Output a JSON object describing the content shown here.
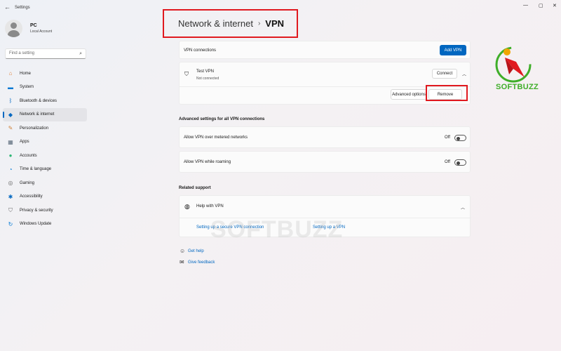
{
  "window": {
    "title": "Settings",
    "controls": {
      "minimize": "—",
      "maximize": "▢",
      "close": "✕"
    }
  },
  "account": {
    "name": "PC",
    "type": "Local Account"
  },
  "search": {
    "placeholder": "Find a setting"
  },
  "sidebar": {
    "items": [
      {
        "label": "Home",
        "icon": "home-icon",
        "glyph": "⌂",
        "color": "#e0823c"
      },
      {
        "label": "System",
        "icon": "monitor-icon",
        "glyph": "▬",
        "color": "#0078d4"
      },
      {
        "label": "Bluetooth & devices",
        "icon": "bluetooth-icon",
        "glyph": "ᛒ",
        "color": "#0067c0"
      },
      {
        "label": "Network & internet",
        "icon": "wifi-icon",
        "glyph": "◆",
        "color": "#0067c0"
      },
      {
        "label": "Personalization",
        "icon": "brush-icon",
        "glyph": "✎",
        "color": "#d0813a"
      },
      {
        "label": "Apps",
        "icon": "apps-icon",
        "glyph": "▦",
        "color": "#5b6b7b"
      },
      {
        "label": "Accounts",
        "icon": "person-icon",
        "glyph": "●",
        "color": "#2bb673"
      },
      {
        "label": "Time & language",
        "icon": "globe-clock-icon",
        "glyph": "◔",
        "color": "#0078d4"
      },
      {
        "label": "Gaming",
        "icon": "controller-icon",
        "glyph": "◎",
        "color": "#6b6b6b"
      },
      {
        "label": "Accessibility",
        "icon": "accessibility-icon",
        "glyph": "✱",
        "color": "#0067c0"
      },
      {
        "label": "Privacy & security",
        "icon": "shield-icon",
        "glyph": "⛉",
        "color": "#6b6b6b"
      },
      {
        "label": "Windows Update",
        "icon": "update-icon",
        "glyph": "↻",
        "color": "#0078d4"
      }
    ],
    "active_index": 3
  },
  "header": {
    "parent": "Network & internet",
    "separator": "›",
    "current": "VPN"
  },
  "vpn": {
    "connections_label": "VPN connections",
    "add_button": "Add VPN",
    "entry": {
      "name": "Test VPN",
      "status": "Not connected",
      "connect_button": "Connect"
    },
    "advanced_options_button": "Advanced options",
    "remove_button": "Remove"
  },
  "advanced": {
    "title": "Advanced settings for all VPN connections",
    "metered": {
      "label": "Allow VPN over metered networks",
      "state": "Off"
    },
    "roaming": {
      "label": "Allow VPN while roaming",
      "state": "Off"
    }
  },
  "support": {
    "title": "Related support",
    "help_label": "Help with VPN",
    "links": [
      "Setting up a secure VPN connection",
      "Setting up a VPN"
    ]
  },
  "footer": {
    "get_help": "Get help",
    "give_feedback": "Give feedback"
  },
  "branding": {
    "watermark": "SOFTBUZZ",
    "logo_text": "SOFTBUZZ"
  },
  "colors": {
    "accent": "#0067c0",
    "highlight": "#e0191f",
    "logo_green": "#3fae29"
  }
}
